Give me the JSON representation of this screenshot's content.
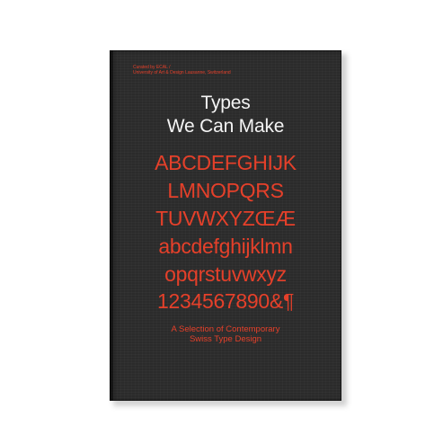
{
  "book": {
    "credit_line1": "Curated by ECAL /",
    "credit_line2": "University of Art & Design Lausanne, Switzerland",
    "title_line1": "Types",
    "title_line2": "We Can Make",
    "specimen": [
      "ABCDEFGHIJK",
      "LMNOPQRS",
      "TUVWXYZŒÆ",
      "abcdefghijklmn",
      "opqrstuvwxyz",
      "1234567890&¶"
    ],
    "subtitle_line1": "A Selection of Contemporary",
    "subtitle_line2": "Swiss Type Design"
  },
  "colors": {
    "cover": "#2b2b2b",
    "accent_red": "#e5402a",
    "title_white": "#f4f4f4",
    "background": "#ffffff"
  }
}
